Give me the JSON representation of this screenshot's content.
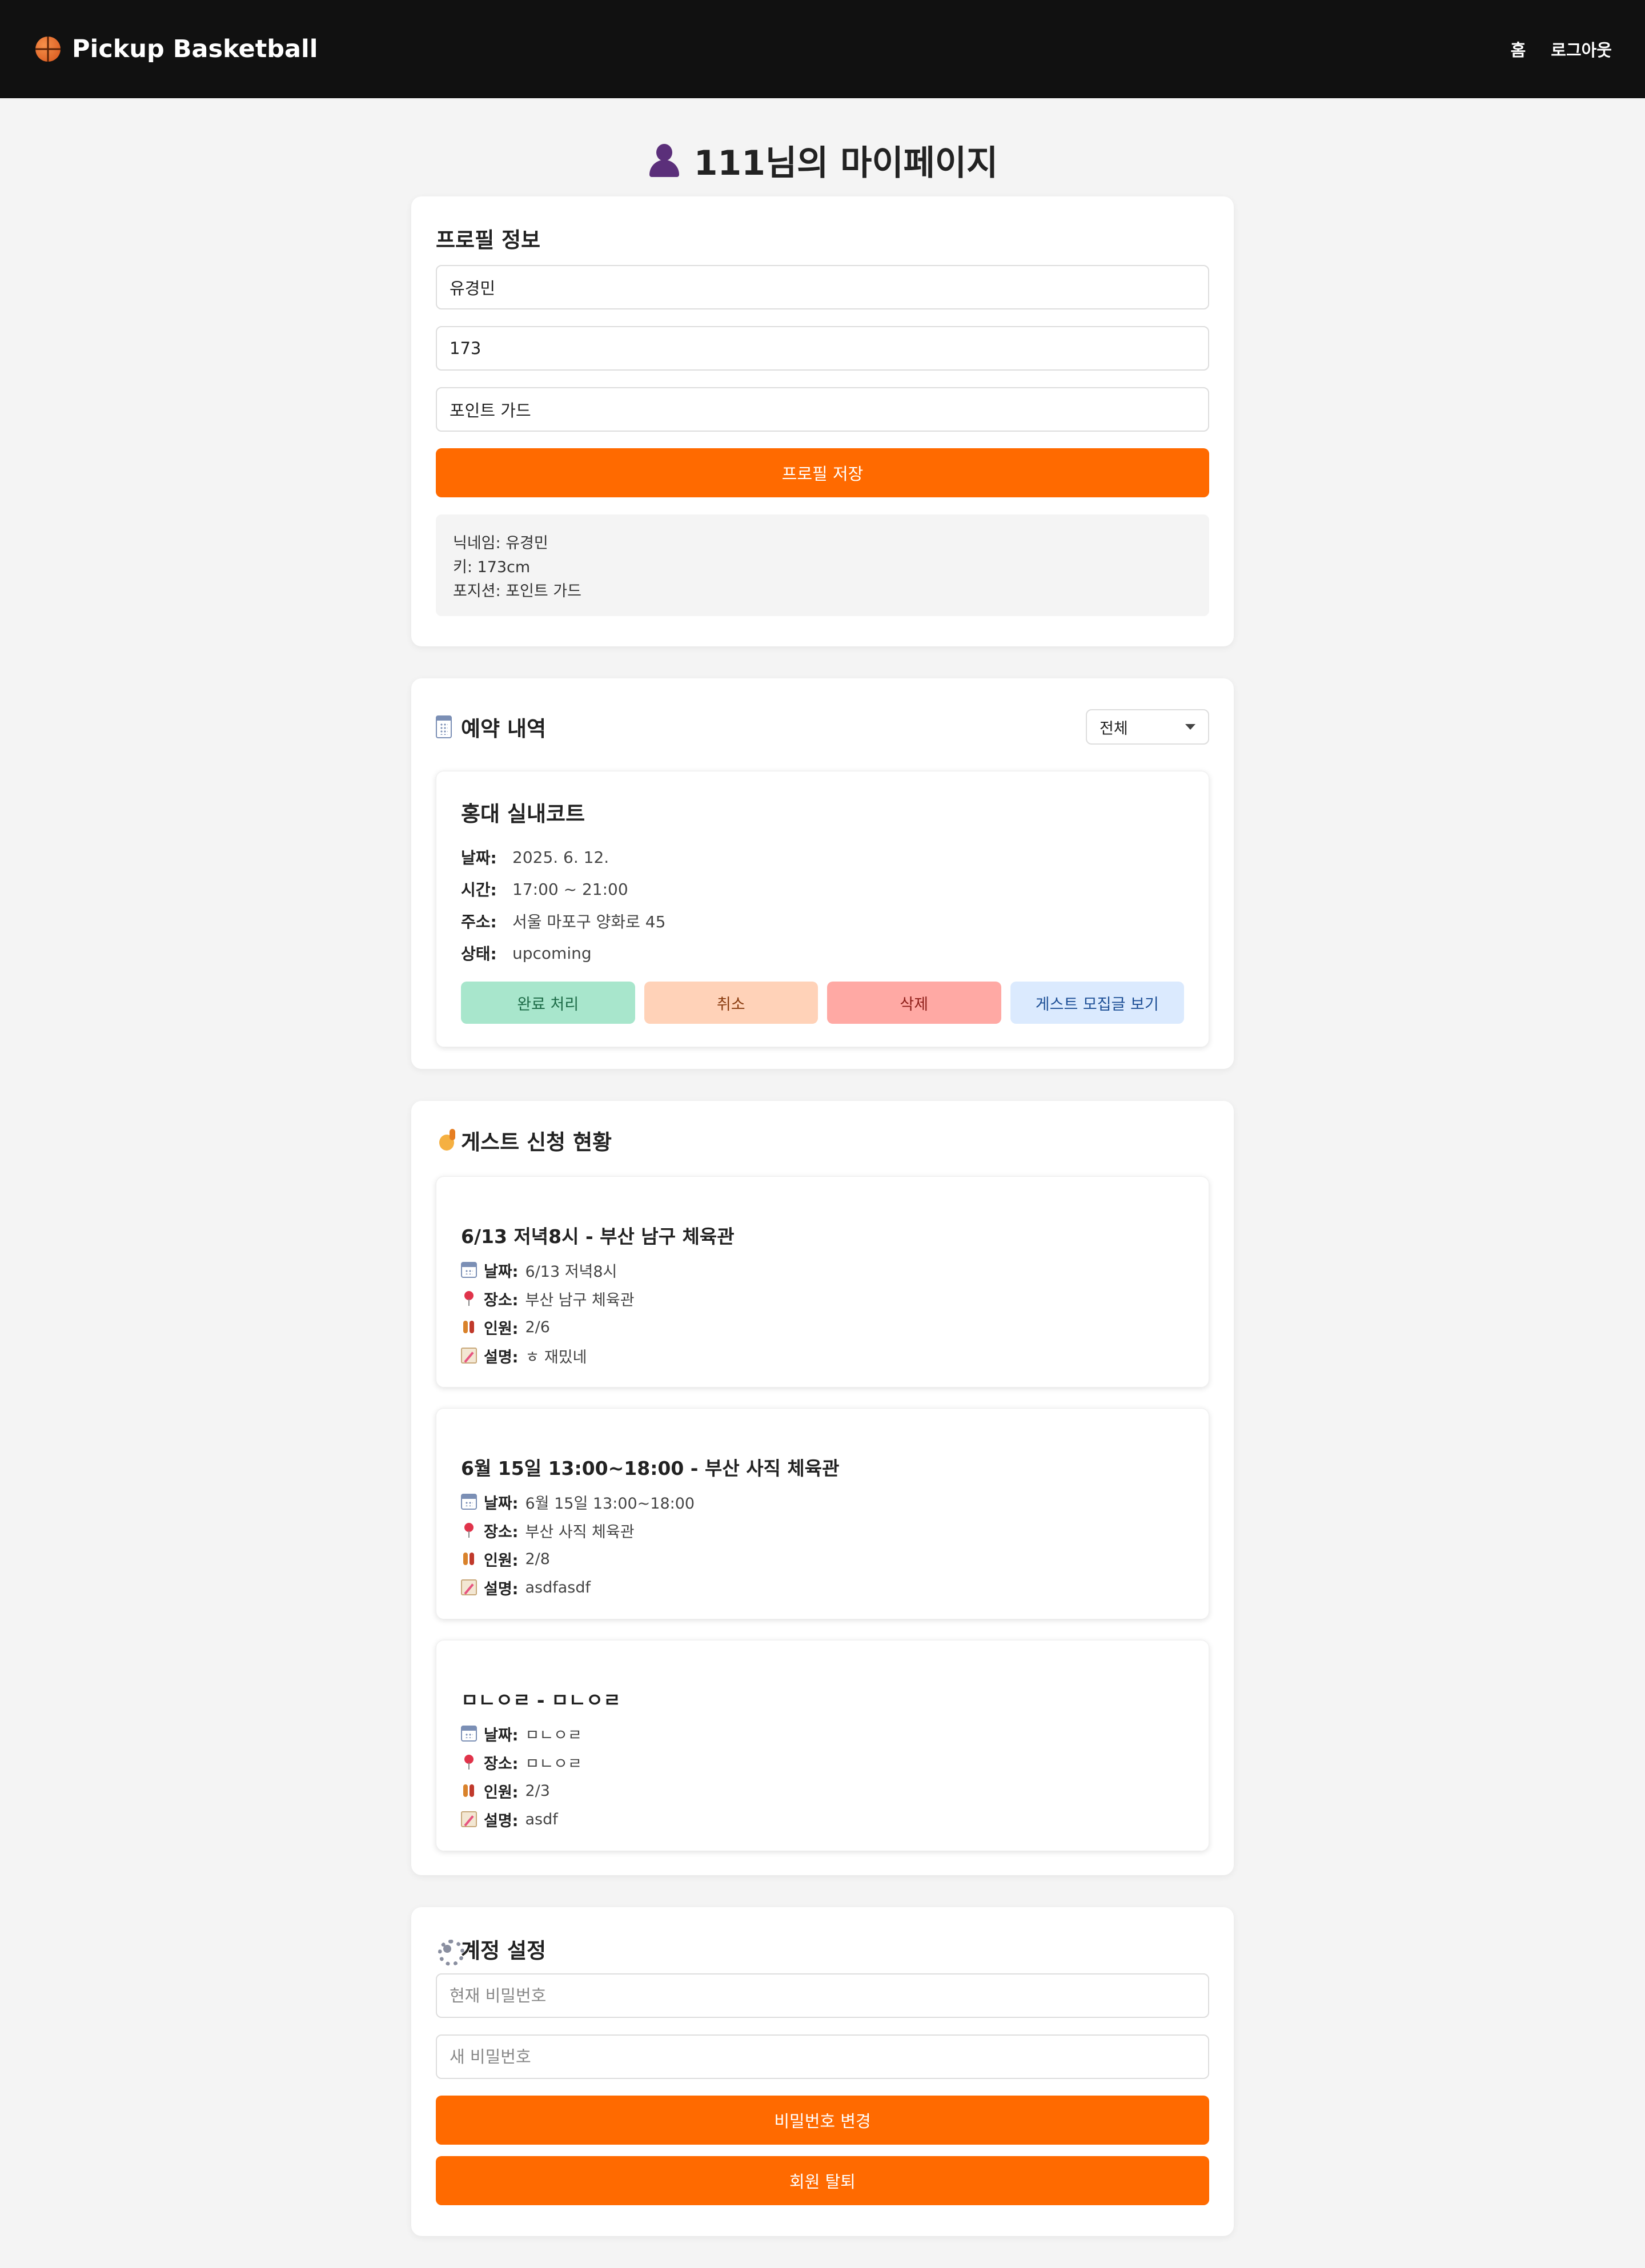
{
  "header": {
    "brand": "Pickup Basketball",
    "nav": {
      "home": "홈",
      "logout": "로그아웃"
    }
  },
  "page": {
    "title": "111님의 마이페이지"
  },
  "profile": {
    "heading": "프로필 정보",
    "name_value": "유경민",
    "height_value": "173",
    "position_value": "포인트 가드",
    "save_label": "프로필 저장",
    "summary": {
      "nickname": "닉네임: 유경민",
      "height": "키: 173cm",
      "position": "포지션: 포인트 가드"
    }
  },
  "reservations": {
    "heading": "예약 내역",
    "filter_value": "전체",
    "items": [
      {
        "name": "홍대 실내코트",
        "date_label": "날짜:",
        "date": "2025. 6. 12.",
        "time_label": "시간:",
        "time": "17:00 ~ 21:00",
        "address_label": "주소:",
        "address": "서울 마포구 양화로 45",
        "status_label": "상태:",
        "status": "upcoming",
        "actions": {
          "complete": "완료 처리",
          "cancel": "취소",
          "delete": "삭제",
          "view_guest": "게스트 모집글 보기"
        }
      }
    ]
  },
  "guest_applications": {
    "heading": "게스트 신청 현황",
    "labels": {
      "date": "날짜:",
      "place": "장소:",
      "people": "인원:",
      "desc": "설명:"
    },
    "items": [
      {
        "title": "6/13 저녁8시 - 부산 남구 체육관",
        "date": "6/13 저녁8시",
        "place": "부산 남구 체육관",
        "people": "2/6",
        "desc": "ㅎ 재밌네"
      },
      {
        "title": "6월 15일 13:00~18:00 - 부산 사직 체육관",
        "date": "6월 15일 13:00~18:00",
        "place": "부산 사직 체육관",
        "people": "2/8",
        "desc": "asdfasdf"
      },
      {
        "title": "ㅁㄴㅇㄹ - ㅁㄴㅇㄹ",
        "date": "ㅁㄴㅇㄹ",
        "place": "ㅁㄴㅇㄹ",
        "people": "2/3",
        "desc": "asdf"
      }
    ]
  },
  "account": {
    "heading": "계정 설정",
    "current_pw_placeholder": "현재 비밀번호",
    "new_pw_placeholder": "새 비밀번호",
    "change_pw_label": "비밀번호 변경",
    "withdraw_label": "회원 탈퇴"
  },
  "colors": {
    "accent": "#ff6a00",
    "header_bg": "#111111",
    "page_bg": "#f4f4f4"
  },
  "icons": {
    "brand": "basketball-icon",
    "title": "person-icon",
    "reservations": "calendar-icon",
    "guest": "raising-hand-icon",
    "account": "gear-icon"
  }
}
